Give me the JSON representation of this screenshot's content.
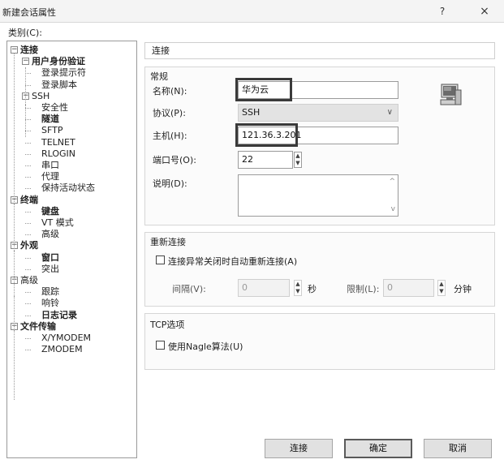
{
  "window": {
    "title": "新建会话属性",
    "help": "?",
    "close": "×"
  },
  "category_label": "类别(C):",
  "tree": [
    {
      "label": "连接",
      "bold": true,
      "toggle": "−"
    },
    {
      "label": "用户身份验证",
      "bold": true,
      "toggle": "−"
    },
    {
      "label": "登录提示符",
      "bold": false
    },
    {
      "label": "登录脚本",
      "bold": false
    },
    {
      "label": "SSH",
      "bold": false,
      "toggle": "−"
    },
    {
      "label": "安全性",
      "bold": false
    },
    {
      "label": "隧道",
      "bold": true
    },
    {
      "label": "SFTP",
      "bold": false
    },
    {
      "label": "TELNET",
      "bold": false
    },
    {
      "label": "RLOGIN",
      "bold": false
    },
    {
      "label": "串口",
      "bold": false
    },
    {
      "label": "代理",
      "bold": false
    },
    {
      "label": "保持活动状态",
      "bold": false
    },
    {
      "label": "终端",
      "bold": true,
      "toggle": "−"
    },
    {
      "label": "键盘",
      "bold": true
    },
    {
      "label": "VT 模式",
      "bold": false
    },
    {
      "label": "高级",
      "bold": false
    },
    {
      "label": "外观",
      "bold": true,
      "toggle": "−"
    },
    {
      "label": "窗口",
      "bold": true
    },
    {
      "label": "突出",
      "bold": false
    },
    {
      "label": "高级",
      "bold": false,
      "toggle": "−"
    },
    {
      "label": "跟踪",
      "bold": false
    },
    {
      "label": "响铃",
      "bold": false
    },
    {
      "label": "日志记录",
      "bold": true
    },
    {
      "label": "文件传输",
      "bold": true,
      "toggle": "−"
    },
    {
      "label": "X/YMODEM",
      "bold": false
    },
    {
      "label": "ZMODEM",
      "bold": false
    }
  ],
  "breadcrumb": "连接",
  "general": {
    "title": "常规",
    "name_label": "名称(N):",
    "name_value": "华为云",
    "protocol_label": "协议(P):",
    "protocol_value": "SSH",
    "host_label": "主机(H):",
    "host_value": "121.36.3.201",
    "port_label": "端口号(O):",
    "port_value": "22",
    "desc_label": "说明(D):",
    "desc_value": ""
  },
  "reconnect": {
    "title": "重新连接",
    "checkbox_label": "连接异常关闭时自动重新连接(A)",
    "checked": false,
    "interval_label": "间隔(V):",
    "interval_value": "0",
    "interval_unit": "秒",
    "limit_label": "限制(L):",
    "limit_value": "0",
    "limit_unit": "分钟"
  },
  "tcp": {
    "title": "TCP选项",
    "nagle_label": "使用Nagle算法(U)",
    "checked": false
  },
  "buttons": {
    "connect": "连接",
    "ok": "确定",
    "cancel": "取消"
  },
  "icons": {
    "toggle_glyph": "−",
    "computer": "computer-icon",
    "spin_up": "▲",
    "spin_down": "▼",
    "dropdown": "∨"
  }
}
